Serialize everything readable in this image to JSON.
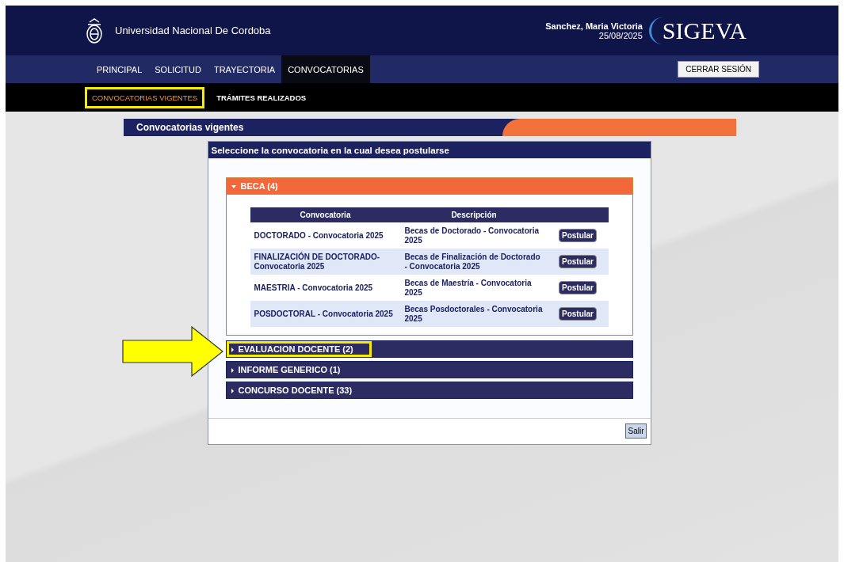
{
  "header": {
    "university": "Universidad Nacional De Cordoba",
    "user": "Sanchez, Maria Victoria",
    "date": "25/08/2025",
    "logo": "SIGEVA"
  },
  "nav": {
    "tabs": [
      {
        "label": "PRINCIPAL",
        "selected": false
      },
      {
        "label": "SOLICITUD",
        "selected": false
      },
      {
        "label": "TRAYECTORIA",
        "selected": false
      },
      {
        "label": "CONVOCATORIAS",
        "selected": true
      }
    ],
    "logout": "CERRAR SESIÓN"
  },
  "subnav": [
    {
      "label": "CONVOCATORIAS VIGENTES",
      "selected": true,
      "highlighted": true
    },
    {
      "label": "TRÁMITES REALIZADOS",
      "selected": false,
      "highlighted": false
    }
  ],
  "page_title": "Convocatorias vigentes",
  "panel": {
    "title": "Seleccione la convocatoria en la cual desea postularse",
    "sections": [
      {
        "label": "BECA (4)",
        "expanded": true,
        "highlighted": false,
        "pointed": false,
        "table": {
          "columns": [
            "Convocatoria",
            "Descripción"
          ],
          "rows": [
            {
              "convocatoria": "DOCTORADO - Convocatoria 2025",
              "descripcion": "Becas de Doctorado - Convocatoria 2025",
              "action": "Postular"
            },
            {
              "convocatoria": "FINALIZACIÓN DE DOCTORADO- Convocatoria 2025",
              "descripcion": "Becas de Finalización de Doctorado - Convocatoria 2025",
              "action": "Postular"
            },
            {
              "convocatoria": "MAESTRIA - Convocatoria 2025",
              "descripcion": "Becas de Maestría - Convocatoria 2025",
              "action": "Postular"
            },
            {
              "convocatoria": "POSDOCTORAL - Convocatoria 2025",
              "descripcion": "Becas Posdoctorales - Convocatoria 2025",
              "action": "Postular"
            }
          ]
        }
      },
      {
        "label": "EVALUACION DOCENTE (2)",
        "expanded": false,
        "highlighted": true,
        "pointed": true
      },
      {
        "label": "INFORME GENERICO (1)",
        "expanded": false,
        "highlighted": false,
        "pointed": false
      },
      {
        "label": "CONCURSO DOCENTE (33)",
        "expanded": false,
        "highlighted": false,
        "pointed": false
      }
    ],
    "exit": "Salir"
  }
}
